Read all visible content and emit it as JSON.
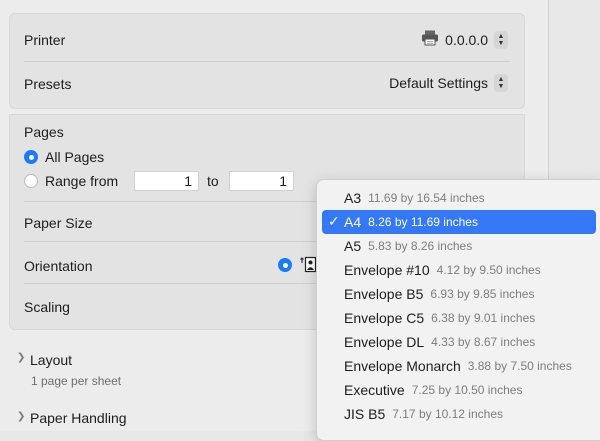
{
  "printer": {
    "label": "Printer",
    "value": "0.0.0.0"
  },
  "presets": {
    "label": "Presets",
    "value": "Default Settings"
  },
  "pages": {
    "title": "Pages",
    "all_pages": "All Pages",
    "range_from": "Range from",
    "from_value": "1",
    "to_label": "to",
    "to_value": "1"
  },
  "paper_size": {
    "label": "Paper Size"
  },
  "orientation": {
    "label": "Orientation"
  },
  "scaling": {
    "label": "Scaling"
  },
  "layout": {
    "title": "Layout",
    "subtitle": "1 page per sheet"
  },
  "paper_handling": {
    "title": "Paper Handling"
  },
  "paper_menu": {
    "items": [
      {
        "name": "A3",
        "dims": "11.69 by 16.54 inches",
        "selected": false
      },
      {
        "name": "A4",
        "dims": "8.26 by 11.69 inches",
        "selected": true
      },
      {
        "name": "A5",
        "dims": "5.83 by 8.26 inches",
        "selected": false
      },
      {
        "name": "Envelope #10",
        "dims": "4.12 by 9.50 inches",
        "selected": false
      },
      {
        "name": "Envelope B5",
        "dims": "6.93 by 9.85 inches",
        "selected": false
      },
      {
        "name": "Envelope C5",
        "dims": "6.38 by 9.01 inches",
        "selected": false
      },
      {
        "name": "Envelope DL",
        "dims": "4.33 by 8.67 inches",
        "selected": false
      },
      {
        "name": "Envelope Monarch",
        "dims": "3.88 by 7.50 inches",
        "selected": false
      },
      {
        "name": "Executive",
        "dims": "7.25 by 10.50 inches",
        "selected": false
      },
      {
        "name": "JIS B5",
        "dims": "7.17 by 10.12 inches",
        "selected": false
      }
    ]
  },
  "colors": {
    "accent": "#3478f6",
    "radio_on": "#1a7cf5"
  }
}
